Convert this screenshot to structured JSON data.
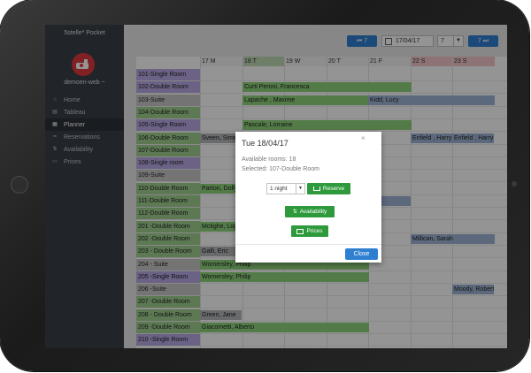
{
  "sidebar": {
    "brand": "5stelle* Pocket",
    "user": "demoen-web ~",
    "items": [
      {
        "label": "Home",
        "icon": "home-icon"
      },
      {
        "label": "Tableau",
        "icon": "chart-icon"
      },
      {
        "label": "Planner",
        "icon": "calendar-icon",
        "active": true
      },
      {
        "label": "Reservations",
        "icon": "bed-icon"
      },
      {
        "label": "Availability",
        "icon": "sort-icon"
      },
      {
        "label": "Prices",
        "icon": "money-icon"
      }
    ]
  },
  "toolbar": {
    "prev_label": "⏮ 7",
    "date_value": "17/04/17",
    "days_value": "7",
    "next_label": "7 ⏭"
  },
  "planner": {
    "days": [
      {
        "label": "17 M",
        "weekend": false
      },
      {
        "label": "18 T",
        "weekend": false,
        "today": true
      },
      {
        "label": "19 W",
        "weekend": false
      },
      {
        "label": "20 T",
        "weekend": false
      },
      {
        "label": "21 F",
        "weekend": false
      },
      {
        "label": "22 S",
        "weekend": true
      },
      {
        "label": "23 S",
        "weekend": true
      }
    ],
    "rooms": [
      "101-Single Room",
      "102-Double Room",
      "103-Suite",
      "104-Double Room",
      "105-Single Room",
      "106-Double Room",
      "107-Double Room",
      "108-Single room",
      "109-Suite",
      "110-Double Room",
      "111-Double Room",
      "112-Double Room",
      "201 -Double Room",
      "202 -Double Room",
      "203 - Double Room",
      "204 - Suite",
      "205 -Single Room",
      "206 -Suite",
      "207 -Double Room",
      "208 - Double Room",
      "209 -Double Room",
      "210 -Single Room"
    ],
    "bookings": [
      {
        "row": 1,
        "name": "Curti Peroni, Francesca",
        "type": "g"
      },
      {
        "row": 2,
        "name": "Lapache , Maxime",
        "type": "g"
      },
      {
        "row": 2,
        "name": "Kidd, Lucy",
        "type": "b"
      },
      {
        "row": 4,
        "name": "Pascale, Lorraine",
        "type": "g"
      },
      {
        "row": 5,
        "name": "Sveen, Simen",
        "type": "gr"
      },
      {
        "row": 5,
        "name": "Enfield , Harry",
        "type": "b"
      },
      {
        "row": 5,
        "name": "Enfield , Harry",
        "type": "b"
      },
      {
        "row": 9,
        "name": "Parton, Dolly",
        "type": "g"
      },
      {
        "row": 10,
        "name": "",
        "type": "b"
      },
      {
        "row": 12,
        "name": "Mctighe, Logan",
        "type": "g"
      },
      {
        "row": 13,
        "name": "Millican, Sarah",
        "type": "b"
      },
      {
        "row": 14,
        "name": "Galli, Eric",
        "type": "gr"
      },
      {
        "row": 15,
        "name": "Womersley, Philip",
        "type": "g"
      },
      {
        "row": 16,
        "name": "Womersley, Philip",
        "type": "g"
      },
      {
        "row": 17,
        "name": "Moody, Robert",
        "type": "b"
      },
      {
        "row": 19,
        "name": "Green, Jane",
        "type": "gr"
      },
      {
        "row": 20,
        "name": "Giacometti, Alberto",
        "type": "g"
      }
    ]
  },
  "modal": {
    "title": "Tue 18/04/17",
    "available": "Available rooms: 18",
    "selected": "Selected: 107-Double Room",
    "nights_value": "1 night",
    "reserve_label": "Reserve",
    "availability_label": "Availability",
    "prices_label": "Prices",
    "close_label": "Close",
    "x_label": "×"
  },
  "colors": {
    "sidebar_bg": "#3a4049",
    "accent_blue": "#2f7fd1",
    "booking_green": "#8fd47d",
    "booking_blue": "#9fb6d6",
    "button_green": "#2e9a3b",
    "avatar_red": "#e0393e"
  }
}
